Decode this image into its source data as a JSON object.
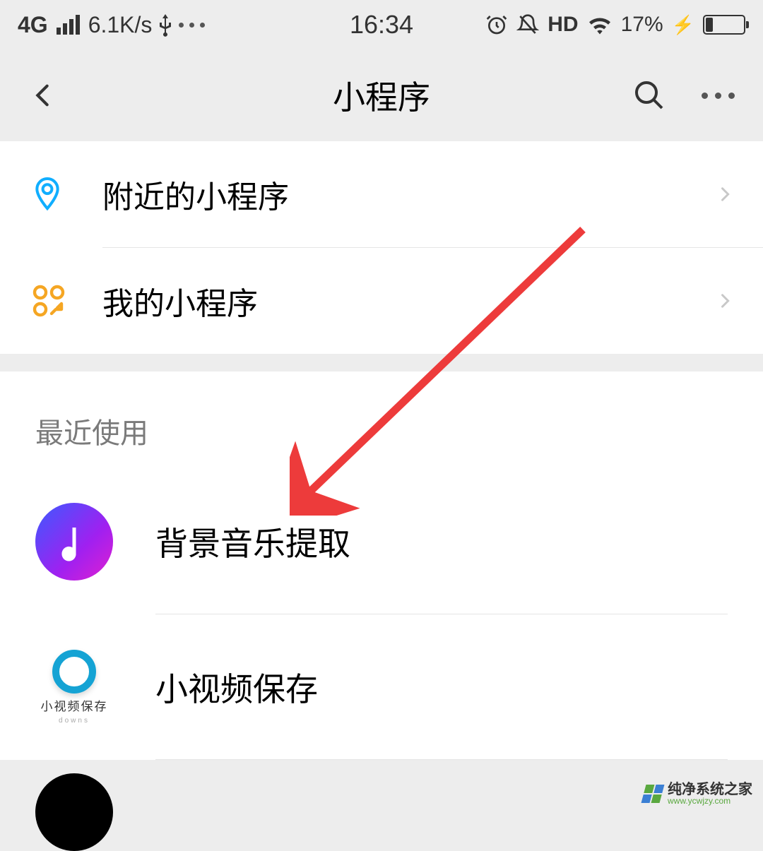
{
  "status": {
    "network": "4G",
    "speed": "6.1K/s",
    "usb": "⎍",
    "time": "16:34",
    "hd": "HD",
    "battery_pct": "17%",
    "charging": "⚡"
  },
  "nav": {
    "title": "小程序"
  },
  "menu": {
    "nearby": "附近的小程序",
    "mine": "我的小程序"
  },
  "recent": {
    "header": "最近使用",
    "items": [
      {
        "label": "背景音乐提取"
      },
      {
        "label": "小视频保存",
        "icon_label": "小视频保存",
        "icon_sub": "downs"
      }
    ]
  },
  "watermark": {
    "main": "纯净系统之家",
    "sub": "www.ycwjzy.com"
  }
}
